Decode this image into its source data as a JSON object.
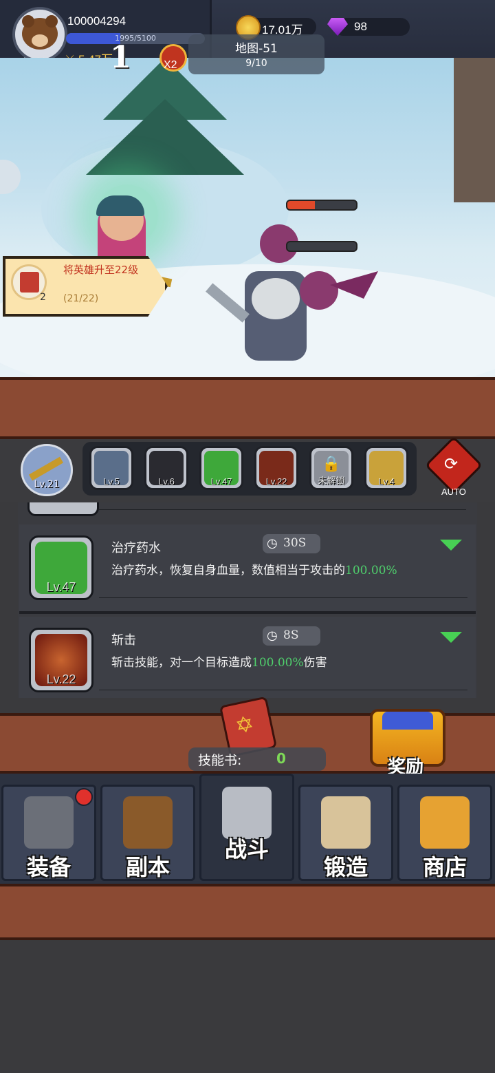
{
  "header": {
    "player_id": "100004294",
    "xp_text": "1995/5100",
    "xp_fraction": 0.391,
    "level": "Lv.21",
    "power": "5.47万",
    "gold": "17.01万",
    "gems": "98",
    "avatar_icon": "bear-avatar-icon",
    "gold_icon": "coin-icon",
    "gem_icon": "purple-gem-icon"
  },
  "battle": {
    "wave_number": "1",
    "speed_label": "X2",
    "map_name": "地图-51",
    "map_progress": "9/10",
    "enemy_hp_fraction": [
      0.4,
      0.0
    ]
  },
  "quest": {
    "title": "将英雄升至22级",
    "count": "2",
    "progress": "(21/22)"
  },
  "skill_slots": {
    "weapon_level": "Lv.21",
    "slots": [
      {
        "label": "Lv.5",
        "color": "#5a6e8a"
      },
      {
        "label": "Lv.6",
        "color": "#2a2a30"
      },
      {
        "label": "Lv.47",
        "color": "#3ea83a"
      },
      {
        "label": "Lv.22",
        "color": "#7a2a1a"
      },
      {
        "label": "未解锁",
        "color": "#8b8f98"
      },
      {
        "label": "Lv.4",
        "color": "#c9a23a"
      }
    ],
    "auto_label": "AUTO"
  },
  "skills": [
    {
      "name": "治疗药水",
      "cooldown": "30S",
      "level": "Lv.47",
      "desc_before": "治疗药水，恢复自身血量，数值相当于攻击的",
      "desc_value": "100.00%",
      "desc_after": "",
      "icon_color": "#3ea83a"
    },
    {
      "name": "斩击",
      "cooldown": "8S",
      "level": "Lv.22",
      "desc_before": "斩击技能，对一个目标造成",
      "desc_value": "100.00%",
      "desc_after": "伤害",
      "icon_color": "#9a2a18"
    }
  ],
  "skill_book": {
    "label": "技能书:",
    "count": "0"
  },
  "reward_label": "奖励",
  "nav": [
    {
      "label": "装备",
      "icon": "helmet-icon",
      "badge": true
    },
    {
      "label": "副本",
      "icon": "sword-shield-icon",
      "badge": false
    },
    {
      "label": "战斗",
      "icon": "crossed-swords-icon",
      "badge": false
    },
    {
      "label": "锻造",
      "icon": "hammer-scroll-icon",
      "badge": false
    },
    {
      "label": "商店",
      "icon": "shop-icon",
      "badge": false
    }
  ],
  "colors": {
    "accent_gold": "#f3c54a",
    "xp_blue": "#3d58d6",
    "highlight_green": "#4fcf6c",
    "panel_brown": "#8b4a33"
  }
}
